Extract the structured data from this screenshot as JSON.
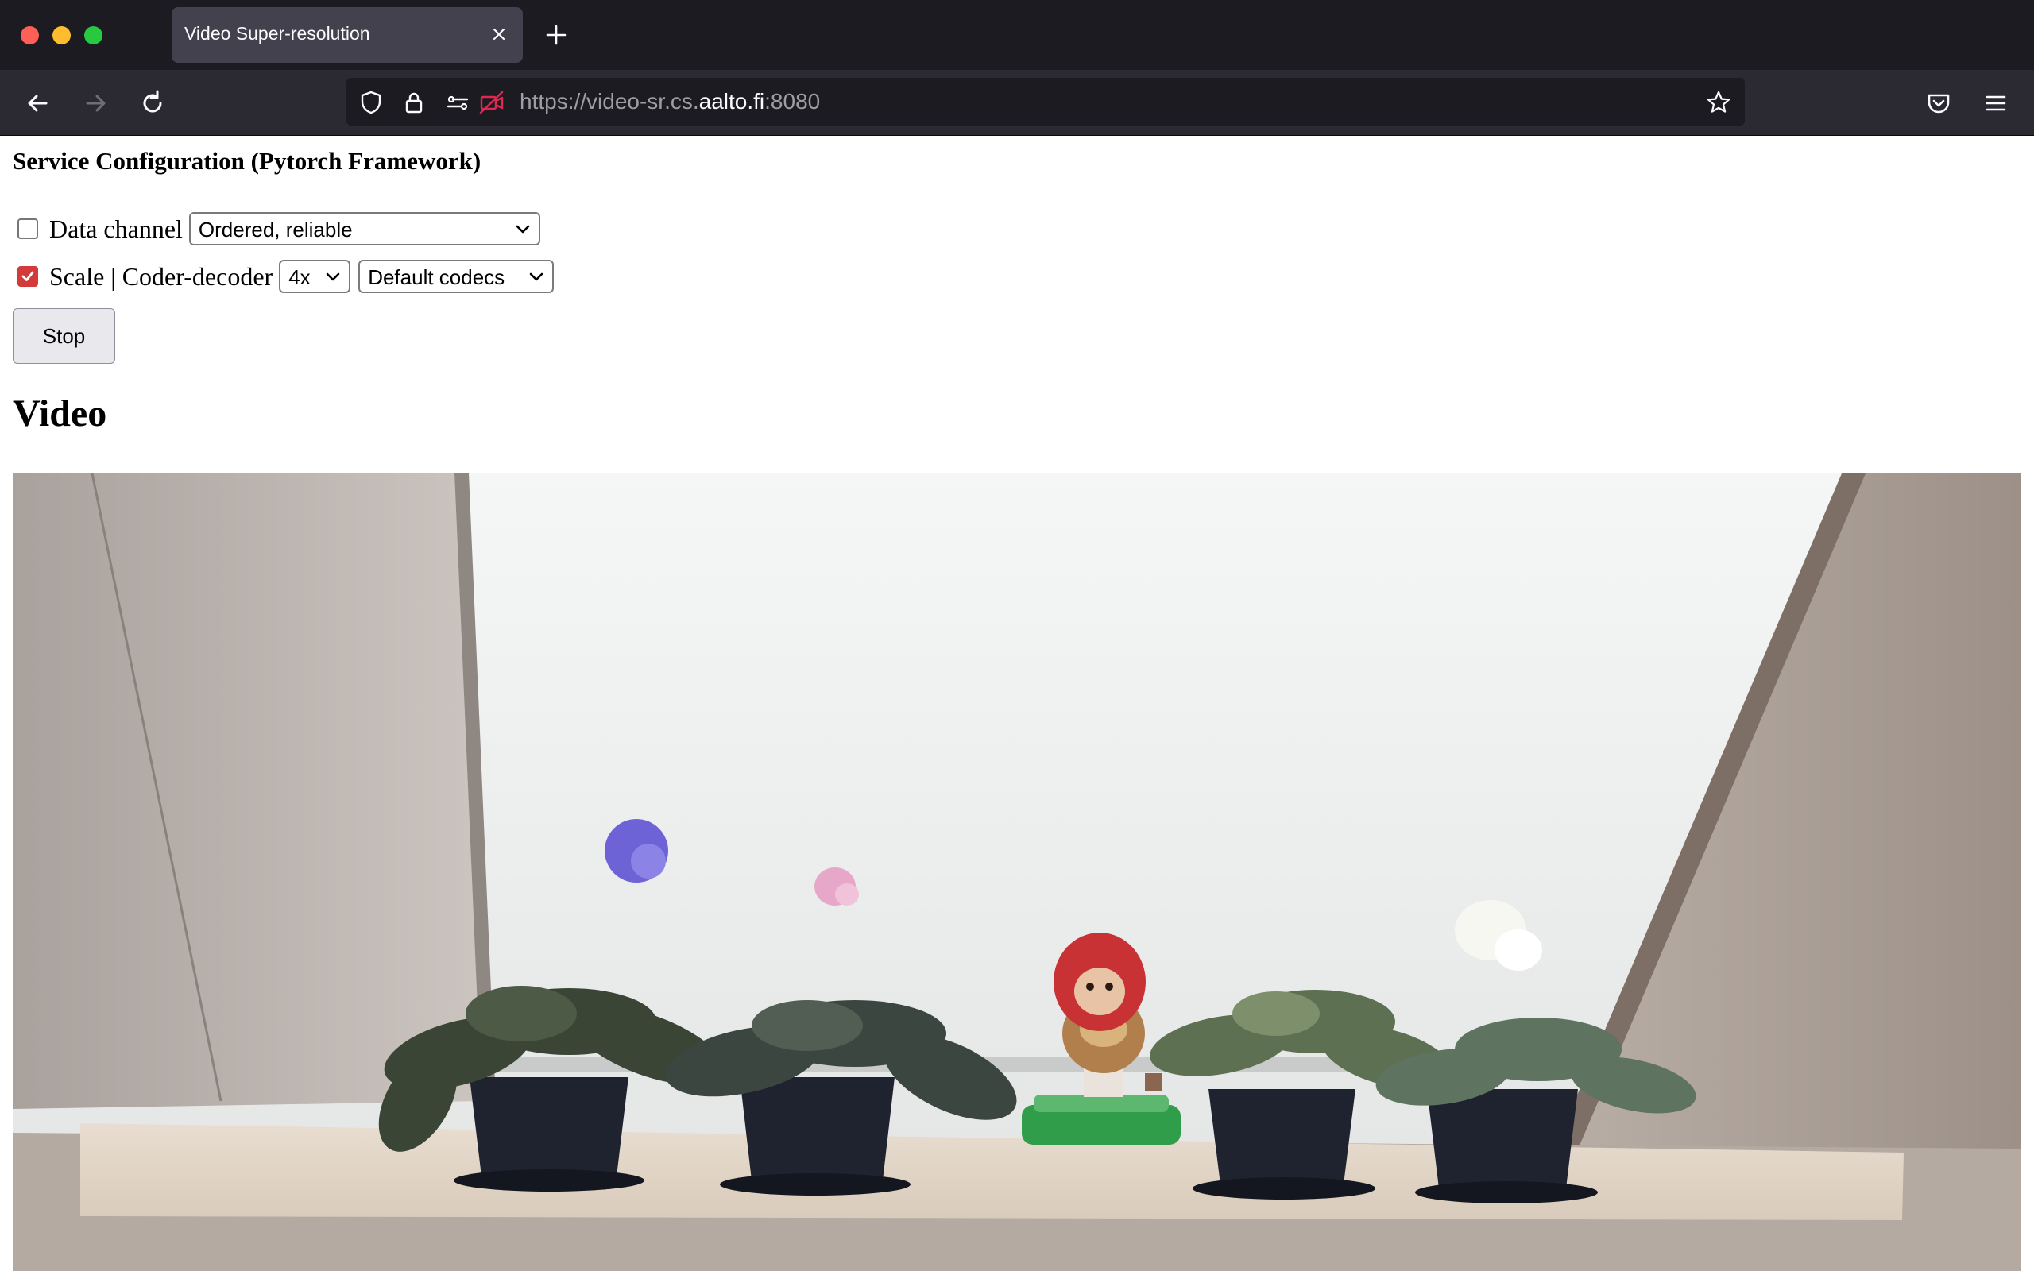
{
  "browser": {
    "tab_title": "Video Super-resolution",
    "url_prefix": "https://video-sr.cs.",
    "url_host": "aalto.fi",
    "url_suffix": ":8080",
    "icons": [
      "close-window-icon",
      "minimize-window-icon",
      "maximize-window-icon",
      "tab-close-icon",
      "new-tab-icon",
      "back-icon",
      "forward-icon",
      "reload-icon",
      "tracking-shield-icon",
      "lock-icon",
      "permissions-icon",
      "camera-blocked-icon",
      "bookmark-star-icon",
      "pocket-icon",
      "menu-icon"
    ]
  },
  "config": {
    "title": "Service Configuration (Pytorch Framework)",
    "data_channel": {
      "checked": false,
      "label": "Data channel",
      "selected": "Ordered, reliable"
    },
    "scale": {
      "checked": true,
      "label": "Scale | Coder-decoder",
      "scale_selected": "4x",
      "codec_selected": "Default codecs"
    },
    "stop_label": "Stop"
  },
  "video": {
    "heading": "Video"
  },
  "colors": {
    "checkbox_checked": "#d33b3b",
    "tabbar_bg": "#1c1b22",
    "navbar_bg": "#2b2a33"
  }
}
